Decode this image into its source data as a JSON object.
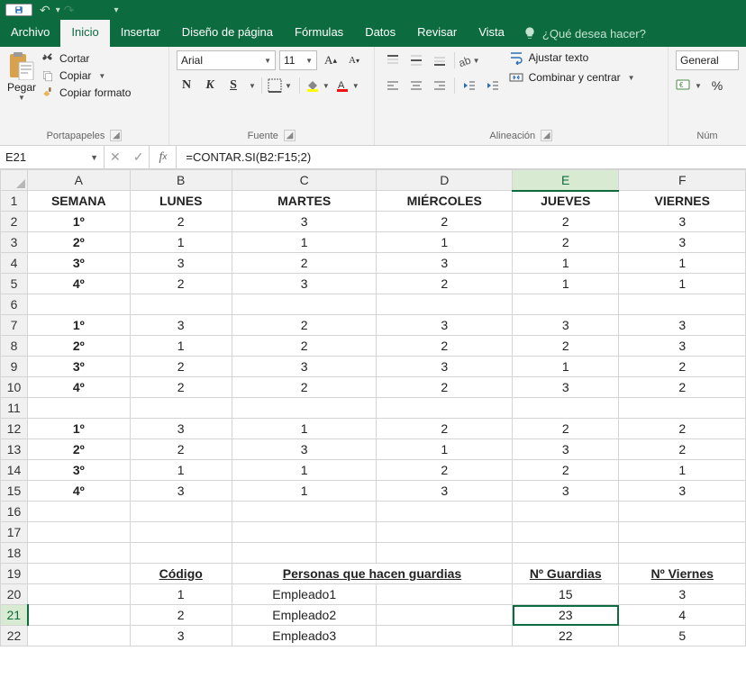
{
  "tabs": {
    "file": "Archivo",
    "home": "Inicio",
    "insert": "Insertar",
    "layout": "Diseño de página",
    "formulas": "Fórmulas",
    "data": "Datos",
    "review": "Revisar",
    "view": "Vista"
  },
  "tell_me": "¿Qué desea hacer?",
  "clipboard": {
    "paste": "Pegar",
    "cut": "Cortar",
    "copy": "Copiar",
    "fmtpainter": "Copiar formato",
    "group": "Portapapeles"
  },
  "font": {
    "name": "Arial",
    "size": "11",
    "group": "Fuente"
  },
  "alignment": {
    "wrap": "Ajustar texto",
    "merge": "Combinar y centrar",
    "group": "Alineación"
  },
  "number": {
    "format": "General",
    "group": "Núm"
  },
  "fx": {
    "cellref": "E21",
    "formula": "=CONTAR.SI(B2:F15;2)"
  },
  "columns": [
    "A",
    "B",
    "C",
    "D",
    "E",
    "F"
  ],
  "row_count": 22,
  "selected_col": "E",
  "selected_row": 21,
  "cells": {
    "1": {
      "A": "SEMANA",
      "B": "LUNES",
      "C": "MARTES",
      "D": "MIÉRCOLES",
      "E": "JUEVES",
      "F": "VIERNES"
    },
    "2": {
      "A": "1º",
      "B": "2",
      "C": "3",
      "D": "2",
      "E": "2",
      "F": "3"
    },
    "3": {
      "A": "2º",
      "B": "1",
      "C": "1",
      "D": "1",
      "E": "2",
      "F": "3"
    },
    "4": {
      "A": "3º",
      "B": "3",
      "C": "2",
      "D": "3",
      "E": "1",
      "F": "1"
    },
    "5": {
      "A": "4º",
      "B": "2",
      "C": "3",
      "D": "2",
      "E": "1",
      "F": "1"
    },
    "6": {},
    "7": {
      "A": "1º",
      "B": "3",
      "C": "2",
      "D": "3",
      "E": "3",
      "F": "3"
    },
    "8": {
      "A": "2º",
      "B": "1",
      "C": "2",
      "D": "2",
      "E": "2",
      "F": "3"
    },
    "9": {
      "A": "3º",
      "B": "2",
      "C": "3",
      "D": "3",
      "E": "1",
      "F": "2"
    },
    "10": {
      "A": "4º",
      "B": "2",
      "C": "2",
      "D": "2",
      "E": "3",
      "F": "2"
    },
    "11": {},
    "12": {
      "A": "1º",
      "B": "3",
      "C": "1",
      "D": "2",
      "E": "2",
      "F": "2"
    },
    "13": {
      "A": "2º",
      "B": "2",
      "C": "3",
      "D": "1",
      "E": "3",
      "F": "2"
    },
    "14": {
      "A": "3º",
      "B": "1",
      "C": "1",
      "D": "2",
      "E": "2",
      "F": "1"
    },
    "15": {
      "A": "4º",
      "B": "3",
      "C": "1",
      "D": "3",
      "E": "3",
      "F": "3"
    },
    "16": {},
    "17": {},
    "18": {},
    "19": {
      "B": "Código",
      "C": "Personas que hacen guardias",
      "E": "Nº Guardias",
      "F": "Nº Viernes"
    },
    "20": {
      "B": "1",
      "C": "Empleado1",
      "E": "15",
      "F": "3"
    },
    "21": {
      "B": "2",
      "C": "Empleado2",
      "E": "23",
      "F": "4"
    },
    "22": {
      "B": "3",
      "C": "Empleado3",
      "E": "22",
      "F": "5"
    }
  },
  "bold_rows": [
    1,
    19
  ],
  "bold_colA_rows": [
    2,
    3,
    4,
    5,
    7,
    8,
    9,
    10,
    12,
    13,
    14,
    15
  ],
  "merge_row19_CD": true,
  "chart_data": {
    "type": "table",
    "title": "Guardias por semana y día",
    "columns": [
      "SEMANA",
      "LUNES",
      "MARTES",
      "MIÉRCOLES",
      "JUEVES",
      "VIERNES"
    ],
    "blocks": [
      [
        [
          "1º",
          2,
          3,
          2,
          2,
          3
        ],
        [
          "2º",
          1,
          1,
          1,
          2,
          3
        ],
        [
          "3º",
          3,
          2,
          3,
          1,
          1
        ],
        [
          "4º",
          2,
          3,
          2,
          1,
          1
        ]
      ],
      [
        [
          "1º",
          3,
          2,
          3,
          3,
          3
        ],
        [
          "2º",
          1,
          2,
          2,
          2,
          3
        ],
        [
          "3º",
          2,
          3,
          3,
          1,
          2
        ],
        [
          "4º",
          2,
          2,
          2,
          3,
          2
        ]
      ],
      [
        [
          "1º",
          3,
          1,
          2,
          2,
          2
        ],
        [
          "2º",
          2,
          3,
          1,
          3,
          2
        ],
        [
          "3º",
          1,
          1,
          2,
          2,
          1
        ],
        [
          "4º",
          3,
          1,
          3,
          3,
          3
        ]
      ]
    ],
    "summary": {
      "columns": [
        "Código",
        "Personas que hacen guardias",
        "Nº Guardias",
        "Nº Viernes"
      ],
      "rows": [
        [
          1,
          "Empleado1",
          15,
          3
        ],
        [
          2,
          "Empleado2",
          23,
          4
        ],
        [
          3,
          "Empleado3",
          22,
          5
        ]
      ]
    }
  }
}
